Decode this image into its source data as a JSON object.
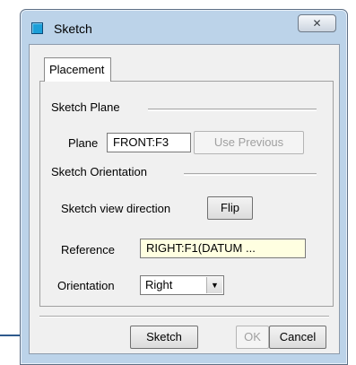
{
  "window": {
    "title": "Sketch",
    "close_glyph": "✕"
  },
  "tabs": [
    {
      "label": "Placement"
    }
  ],
  "sketch_plane": {
    "group_label": "Sketch Plane",
    "plane_label": "Plane",
    "plane_value": "FRONT:F3",
    "use_previous_label": "Use Previous"
  },
  "sketch_orientation": {
    "group_label": "Sketch Orientation",
    "view_direction_label": "Sketch view direction",
    "flip_label": "Flip",
    "reference_label": "Reference",
    "reference_value": "RIGHT:F1(DATUM ...",
    "orientation_label": "Orientation",
    "orientation_value": "Right"
  },
  "footer": {
    "sketch_label": "Sketch",
    "ok_label": "OK",
    "cancel_label": "Cancel"
  },
  "colors": {
    "arrow": "#2e5a8c",
    "reference_bg": "#ffffe1",
    "title_icon": "#1c9fd8"
  }
}
